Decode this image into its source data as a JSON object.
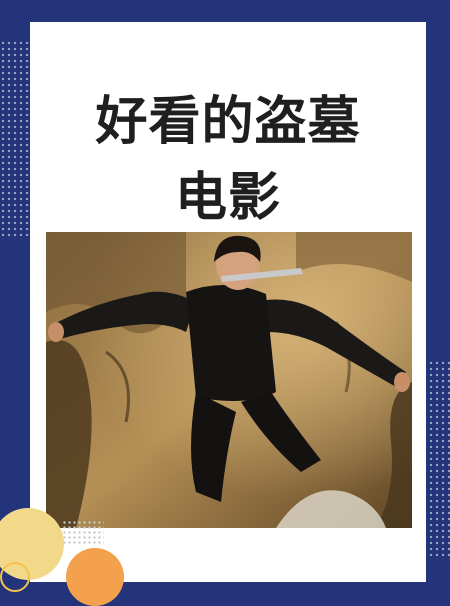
{
  "title": {
    "line1": "好看的盗墓",
    "line2": "电影"
  },
  "colors": {
    "background": "#23347a",
    "card": "#ffffff",
    "title_text": "#1f1f1f",
    "accent_yellow": "#f2d98a",
    "accent_orange": "#f3a14d"
  },
  "image": {
    "subject": "movie-still-woman-climbing-rocks"
  }
}
